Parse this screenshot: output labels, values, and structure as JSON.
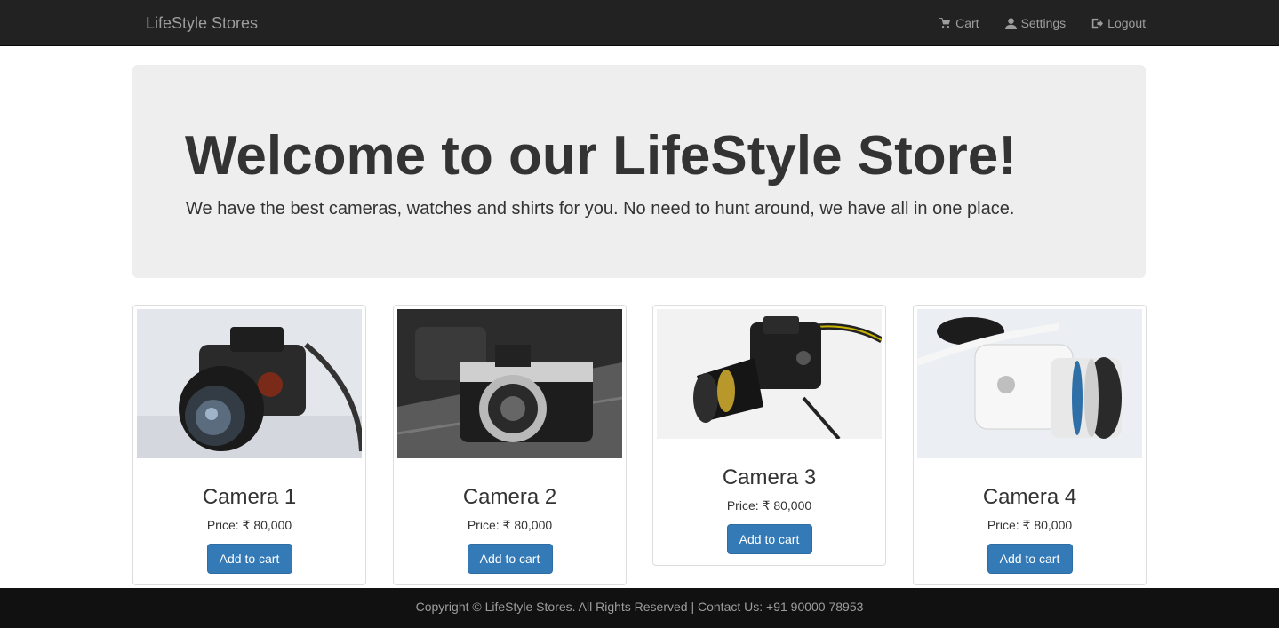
{
  "navbar": {
    "brand": "LifeStyle Stores",
    "links": [
      {
        "label": "Cart",
        "icon": "shopping-cart-icon"
      },
      {
        "label": "Settings",
        "icon": "user-icon"
      },
      {
        "label": "Logout",
        "icon": "logout-icon"
      }
    ]
  },
  "jumbotron": {
    "title": "Welcome to our LifeStyle Store!",
    "subtitle": "We have the best cameras, watches and shirts for you. No need to hunt around, we have all in one place."
  },
  "products": [
    {
      "name": "Camera 1",
      "price": "Price: ₹ 80,000",
      "button": "Add to cart"
    },
    {
      "name": "Camera 2",
      "price": "Price: ₹ 80,000",
      "button": "Add to cart"
    },
    {
      "name": "Camera 3",
      "price": "Price: ₹ 80,000",
      "button": "Add to cart"
    },
    {
      "name": "Camera 4",
      "price": "Price: ₹ 80,000",
      "button": "Add to cart"
    }
  ],
  "footer": {
    "text": "Copyright © LifeStyle Stores. All Rights Reserved | Contact Us: +91 90000 78953"
  },
  "colors": {
    "navbar_bg": "#222222",
    "jumbotron_bg": "#eeeeee",
    "button_primary": "#337ab7",
    "footer_bg": "#111111"
  }
}
